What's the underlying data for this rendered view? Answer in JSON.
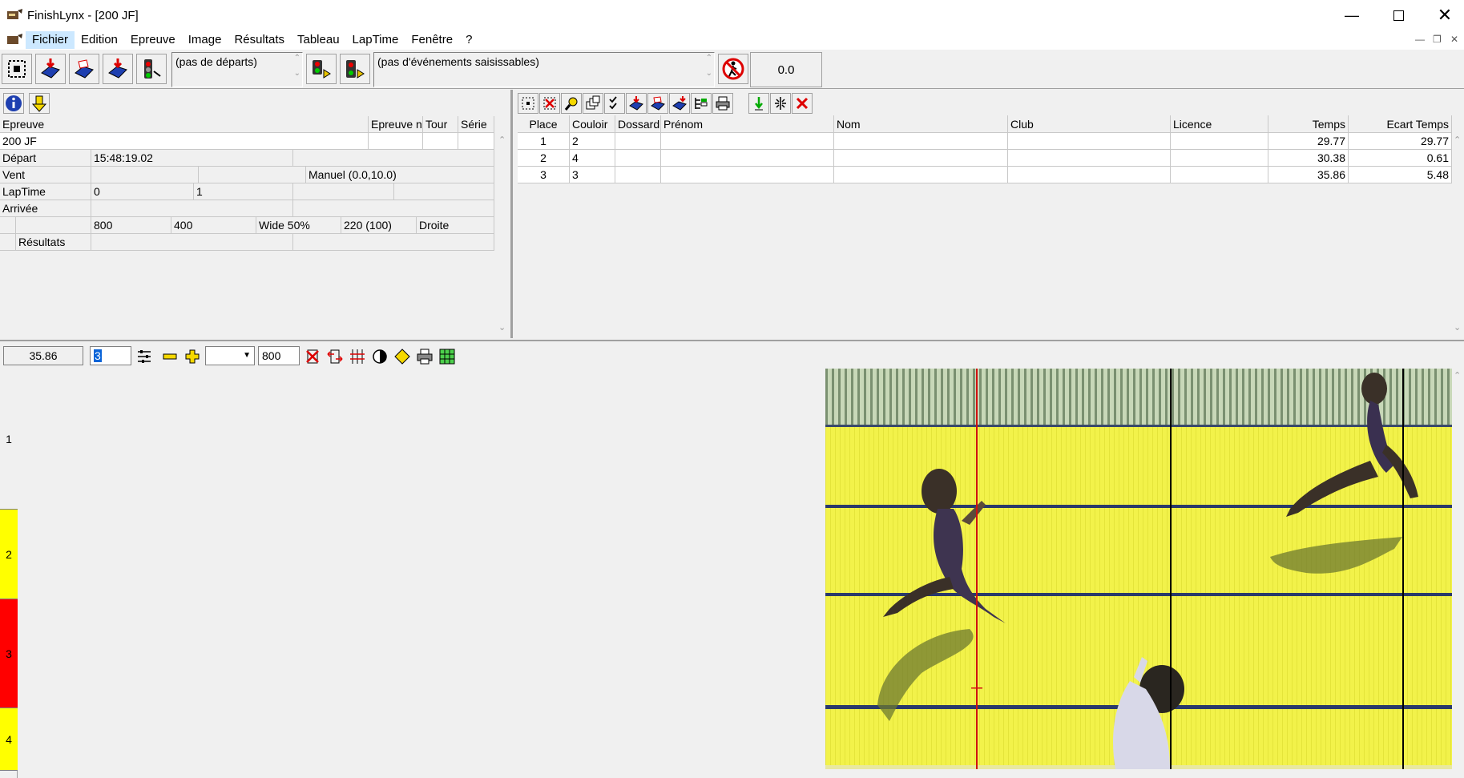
{
  "window": {
    "title": "FinishLynx - [200 JF]"
  },
  "menu": {
    "items": [
      "Fichier",
      "Edition",
      "Epreuve",
      "Image",
      "Résultats",
      "Tableau",
      "LapTime",
      "Fenêtre",
      "?"
    ]
  },
  "toolbar": {
    "starts_box": "(pas de départs)",
    "events_box": "(pas d'événements saisissables)",
    "time_display": "0.0"
  },
  "event_grid": {
    "header": {
      "epreuve": "Epreuve",
      "epreuve_n": "Epreuve n",
      "tour": "Tour",
      "serie": "Série"
    },
    "event_name": "200 JF",
    "depart_label": "Départ",
    "depart_value": "15:48:19.02",
    "vent_label": "Vent",
    "vent_value": "Manuel (0.0,10.0)",
    "laptime_label": "LapTime",
    "laptime_v1": "0",
    "laptime_v2": "1",
    "arrivee_label": "Arrivée",
    "camera_row": [
      "800",
      "400",
      "Wide 50%",
      "220  (100)",
      "Droite"
    ],
    "resultats_label": "Résultats"
  },
  "results": {
    "columns": [
      "Place",
      "Couloir",
      "Dossard",
      "Prénom",
      "Nom",
      "Club",
      "Licence",
      "Temps",
      "Ecart Temps"
    ],
    "rows": [
      {
        "place": "1",
        "couloir": "2",
        "dossard": "",
        "prenom": "",
        "nom": "",
        "club": "",
        "licence": "",
        "temps": "29.77",
        "ecart": "29.77"
      },
      {
        "place": "2",
        "couloir": "4",
        "dossard": "",
        "prenom": "",
        "nom": "",
        "club": "",
        "licence": "",
        "temps": "30.38",
        "ecart": "0.61"
      },
      {
        "place": "3",
        "couloir": "3",
        "dossard": "",
        "prenom": "",
        "nom": "",
        "club": "",
        "licence": "",
        "temps": "35.86",
        "ecart": "5.48"
      }
    ]
  },
  "image_toolbar": {
    "time_value": "35.86",
    "lane_value": "3",
    "density_value": "800"
  },
  "lanes": [
    {
      "label": "1",
      "color": "#f0f0f0"
    },
    {
      "label": "2",
      "color": "#ffff00"
    },
    {
      "label": "3",
      "color": "#ff0000"
    },
    {
      "label": "4",
      "color": "#ffff00"
    }
  ]
}
